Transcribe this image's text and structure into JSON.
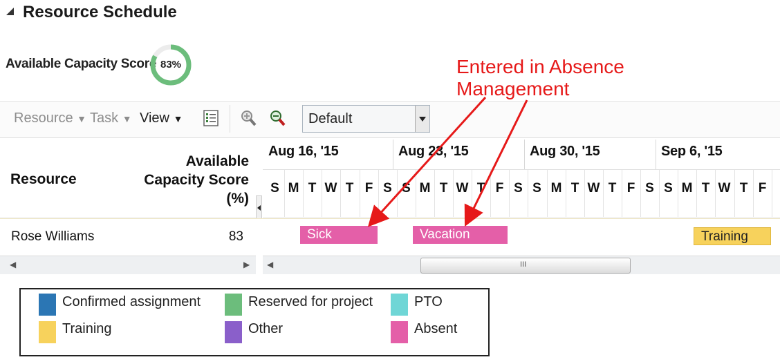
{
  "header": {
    "title": "Resource Schedule"
  },
  "capacity": {
    "label": "Available Capacity Score",
    "score_text": "83%",
    "score": 0.83
  },
  "toolbar": {
    "resource_menu": "Resource",
    "task_menu": "Task",
    "view_menu": "View",
    "view_select": "Default"
  },
  "grid": {
    "col_resource": "Resource",
    "col_capacity": [
      "Available",
      "Capacity Score",
      "(%)"
    ],
    "weeks": [
      "Aug 16, '15",
      "Aug 23, '15",
      "Aug 30, '15",
      "Sep 6, '15"
    ],
    "days": [
      "S",
      "M",
      "T",
      "W",
      "T",
      "F",
      "S"
    ]
  },
  "rows": [
    {
      "name": "Rose Williams",
      "capacity": "83",
      "bars": [
        {
          "label": "Sick",
          "type": "absent"
        },
        {
          "label": "Vacation",
          "type": "absent"
        },
        {
          "label": "Training",
          "type": "training"
        }
      ]
    }
  ],
  "scrollbar": {
    "grip": "III"
  },
  "legend": [
    {
      "label": "Confirmed assignment",
      "color": "#2b76b4"
    },
    {
      "label": "Reserved for project",
      "color": "#6cbd7c"
    },
    {
      "label": "PTO",
      "color": "#6fd6d6"
    },
    {
      "label": "Training",
      "color": "#f7d25c"
    },
    {
      "label": "Other",
      "color": "#8a5fca"
    },
    {
      "label": "Absent",
      "color": "#e45fa8"
    }
  ],
  "annotation": {
    "line1": "Entered in Absence",
    "line2": "Management"
  },
  "colors": {
    "absent": "#e45fa8",
    "training": "#f7d25c",
    "donut": "#6cbd7c",
    "annotation": "#e61919"
  },
  "icons": [
    "collapse-triangle-icon",
    "list-detail-icon",
    "zoom-in-icon",
    "zoom-out-icon",
    "dropdown-arrow-icon"
  ]
}
